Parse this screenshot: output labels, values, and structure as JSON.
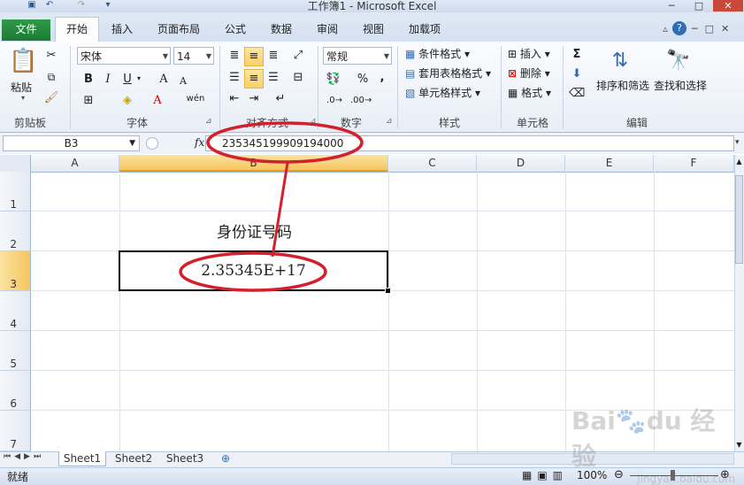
{
  "window": {
    "title": "工作簿1 - Microsoft Excel"
  },
  "qat": {
    "save_icon": "save-icon",
    "undo_icon": "undo-icon",
    "redo_icon": "redo-icon"
  },
  "tabs": [
    "文件",
    "开始",
    "插入",
    "页面布局",
    "公式",
    "数据",
    "审阅",
    "视图",
    "加载项"
  ],
  "ribbon": {
    "clipboard": {
      "paste": "粘贴",
      "label": "剪贴板"
    },
    "font": {
      "name": "宋体",
      "size": "14",
      "label": "字体",
      "grow": "A",
      "shrink": "A",
      "wen": "wén"
    },
    "alignment": {
      "label": "对齐方式"
    },
    "number": {
      "format": "常规",
      "percent": "%",
      "comma": ",",
      "label": "数字"
    },
    "styles": {
      "conditional": "条件格式",
      "table": "套用表格格式",
      "cell": "单元格样式",
      "label": "样式"
    },
    "cells": {
      "insert": "插入",
      "delete": "删除",
      "format": "格式",
      "label": "单元格"
    },
    "editing": {
      "sigma": "Σ",
      "sort": "排序和筛选",
      "find": "查找和选择",
      "label": "编辑"
    }
  },
  "formula_bar": {
    "name_box": "B3",
    "fx": "fx",
    "value": "235345199909194000"
  },
  "columns": [
    "A",
    "B",
    "C",
    "D",
    "E",
    "F"
  ],
  "rows": [
    "1",
    "2",
    "3",
    "4",
    "5",
    "6",
    "7"
  ],
  "cells": {
    "B2": "身份证号码",
    "B3": "2.35345E+17"
  },
  "sheets": [
    "Sheet1",
    "Sheet2",
    "Sheet3"
  ],
  "status": {
    "ready": "就绪",
    "zoom": "100%"
  },
  "watermark": "Bai du 经验 jingyan.baidu.com",
  "colors": {
    "file_tab": "#1d7a33",
    "annotation": "#d4202c",
    "selected": "#f6c55f"
  }
}
